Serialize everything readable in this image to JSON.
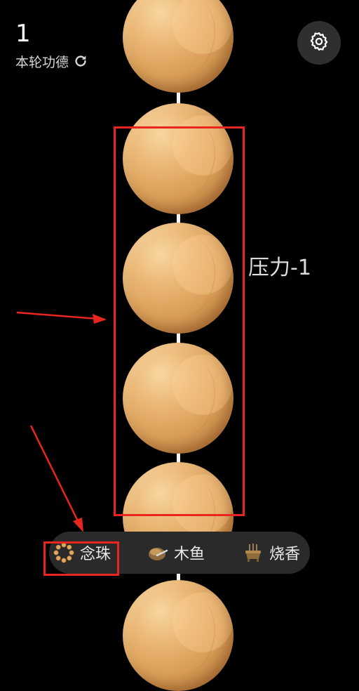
{
  "counter": {
    "value": "1",
    "label": "本轮功德"
  },
  "annotation": {
    "label": "压力-1",
    "color": "#e8261f"
  },
  "tabs": [
    {
      "id": "beads",
      "label": "念珠",
      "icon": "prayer-beads-icon"
    },
    {
      "id": "wooden-fish",
      "label": "木鱼",
      "icon": "wooden-fish-icon"
    },
    {
      "id": "incense",
      "label": "烧香",
      "icon": "incense-burner-icon"
    }
  ],
  "icons": {
    "settings": "gear-icon",
    "refresh": "refresh-icon"
  },
  "colors": {
    "bead": "#e2aa66",
    "background": "#000000",
    "tabbar": "#2a2a2a",
    "string": "#f2f2f2"
  }
}
